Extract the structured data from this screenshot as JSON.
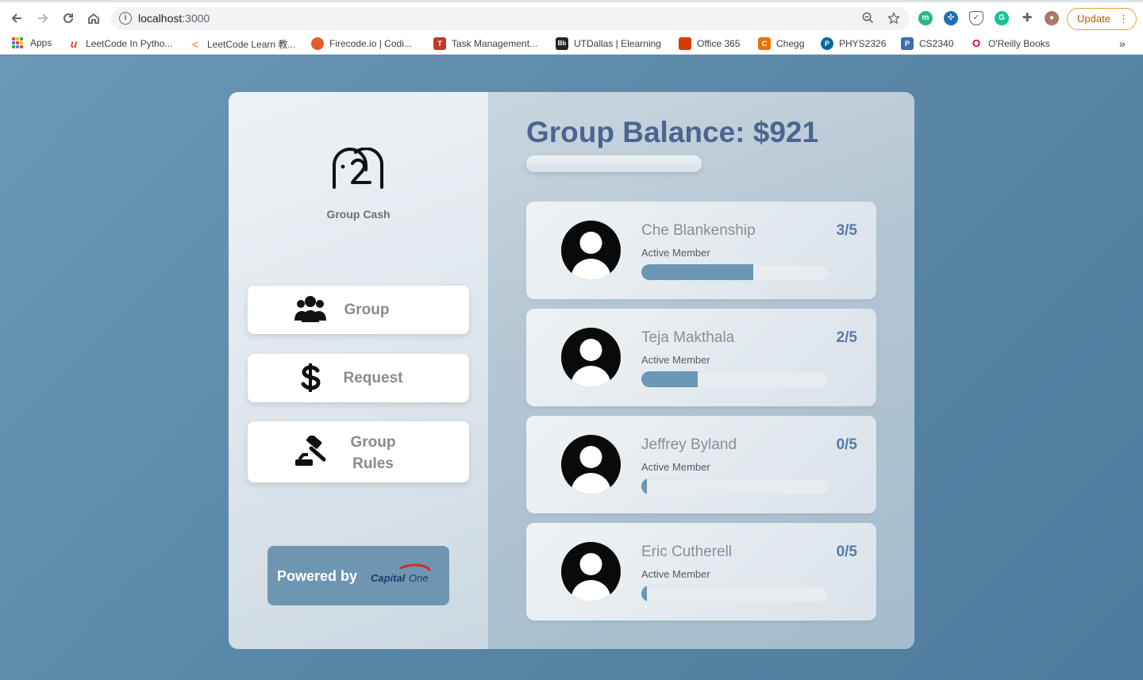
{
  "browser": {
    "url_host": "localhost",
    "url_port": ":3000",
    "update_label": "Update",
    "bookmarks": [
      {
        "label": "Apps",
        "icon": "apps-grid-icon"
      },
      {
        "label": "LeetCode In Pytho...",
        "icon": "leetcode-python-icon",
        "color": "#e8423b"
      },
      {
        "label": "LeetCode Learn 教...",
        "icon": "leetcode-icon",
        "color": "#f2a43a"
      },
      {
        "label": "Firecode.io | Codi...",
        "icon": "firecode-icon",
        "color": "#e85b2f"
      },
      {
        "label": "Task Management...",
        "icon": "task-management-icon",
        "color": "#c0392b"
      },
      {
        "label": "UTDallas | Elearning",
        "icon": "blackboard-icon",
        "color": "#222222"
      },
      {
        "label": "Office 365",
        "icon": "office-icon",
        "color": "#d83b01"
      },
      {
        "label": "Chegg",
        "icon": "chegg-icon",
        "color": "#eb7100"
      },
      {
        "label": "PHYS2326",
        "icon": "pearson-icon",
        "color": "#006a9e"
      },
      {
        "label": "CS2340",
        "icon": "p-icon",
        "color": "#3f6eaa"
      },
      {
        "label": "O'Reilly Books",
        "icon": "oreilly-icon",
        "color": "#d3002d"
      }
    ],
    "more_bookmarks": "»"
  },
  "sidebar": {
    "brand": "Group Cash",
    "nav": [
      {
        "label": "Group",
        "icon": "users-icon"
      },
      {
        "label": "Request",
        "icon": "dollar-icon"
      },
      {
        "label_line1": "Group",
        "label_line2": "Rules",
        "icon": "gavel-icon"
      }
    ],
    "powered_by": "Powered by",
    "partner_logo": "Capital One"
  },
  "main": {
    "title": "Group Balance: $921",
    "members": [
      {
        "name": "Che Blankenship",
        "status": "Active Member",
        "score": "3/5",
        "progress": 0.6
      },
      {
        "name": "Teja Makthala",
        "status": "Active Member",
        "score": "2/5",
        "progress": 0.3
      },
      {
        "name": "Jeffrey Byland",
        "status": "Active Member",
        "score": "0/5",
        "progress": 0.03
      },
      {
        "name": "Eric Cutherell",
        "status": "Active Member",
        "score": "0/5",
        "progress": 0.03
      }
    ]
  },
  "colors": {
    "accent": "#4a6690",
    "score": "#5b79a6",
    "progress": "#6a97b6",
    "background": "#5b88a8"
  }
}
